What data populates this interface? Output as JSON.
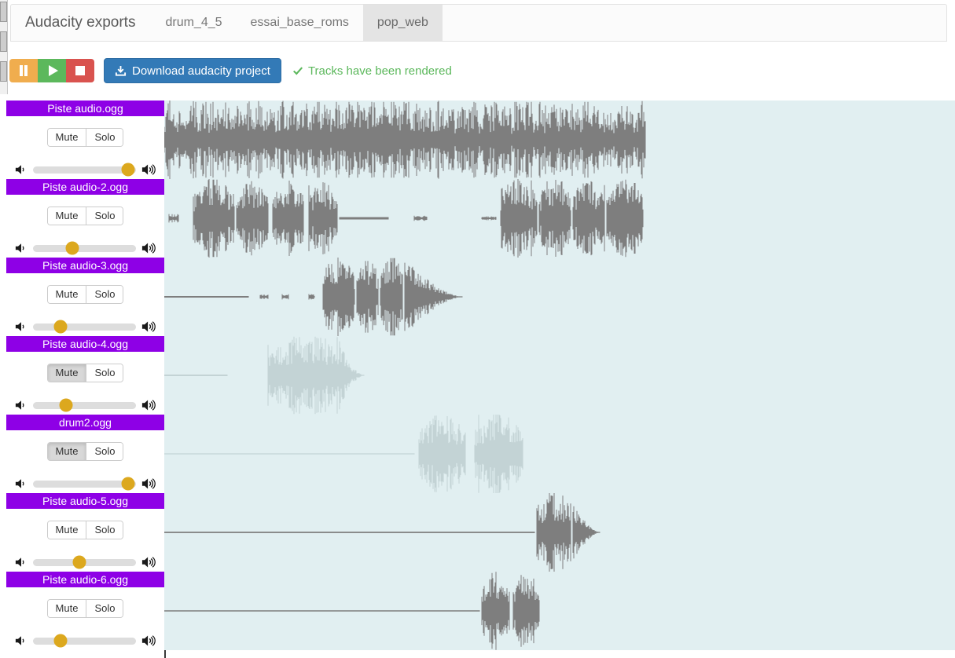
{
  "header": {
    "brand": "Audacity exports",
    "tabs": [
      {
        "label": "drum_4_5",
        "active": false
      },
      {
        "label": "essai_base_roms",
        "active": false
      },
      {
        "label": "pop_web",
        "active": true
      }
    ]
  },
  "toolbar": {
    "pause_icon": "pause-icon",
    "play_icon": "play-icon",
    "stop_icon": "stop-icon",
    "download_label": "Download audacity project",
    "download_icon": "download-icon",
    "status_text": "Tracks have been rendered",
    "status_icon": "check-icon",
    "status_color": "#5cb85c",
    "download_color": "#337ab7"
  },
  "track_controls": {
    "mute_label": "Mute",
    "solo_label": "Solo",
    "volume_low_icon": "speaker-low-icon",
    "volume_high_icon": "speaker-high-icon",
    "title_color": "#8e00e6",
    "knob_color": "#dca81e",
    "wave_bg_color": "#e1eff1",
    "wave_color": "#7e7e7e",
    "wave_muted_color": "#c3d3d5"
  },
  "tracks": [
    {
      "name": "Piste audio.ogg",
      "muted": false,
      "solo": false,
      "volume": 92,
      "wave": "t1"
    },
    {
      "name": "Piste audio-2.ogg",
      "muted": false,
      "solo": false,
      "volume": 38,
      "wave": "t2"
    },
    {
      "name": "Piste audio-3.ogg",
      "muted": false,
      "solo": false,
      "volume": 27,
      "wave": "t3"
    },
    {
      "name": "Piste audio-4.ogg",
      "muted": true,
      "solo": false,
      "volume": 32,
      "wave": "t4"
    },
    {
      "name": "drum2.ogg",
      "muted": true,
      "solo": false,
      "volume": 92,
      "wave": "t5"
    },
    {
      "name": "Piste audio-5.ogg",
      "muted": false,
      "solo": false,
      "volume": 45,
      "wave": "t6"
    },
    {
      "name": "Piste audio-6.ogg",
      "muted": false,
      "solo": false,
      "volume": 27,
      "wave": "t7"
    }
  ]
}
